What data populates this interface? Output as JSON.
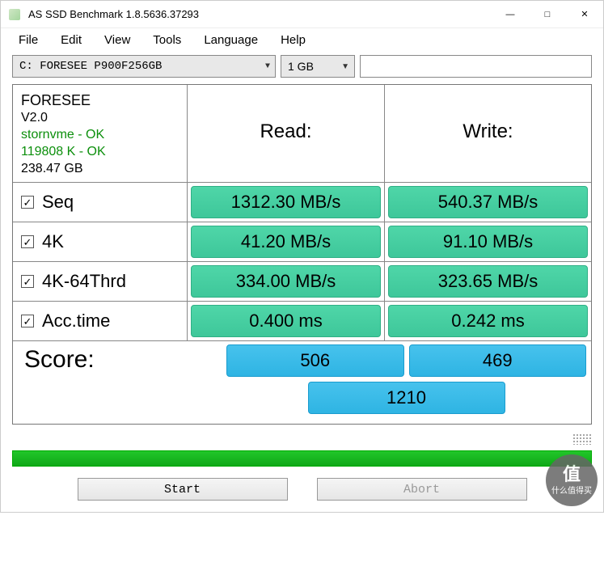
{
  "window": {
    "title": "AS SSD Benchmark 1.8.5636.37293"
  },
  "menu": {
    "file": "File",
    "edit": "Edit",
    "view": "View",
    "tools": "Tools",
    "language": "Language",
    "help": "Help"
  },
  "controls": {
    "drive": "C: FORESEE P900F256GB",
    "size": "1 GB"
  },
  "info": {
    "model": "FORESEE",
    "firmware": "V2.0",
    "driver_line": "stornvme - OK",
    "align_line": "119808 K - OK",
    "capacity": "238.47 GB"
  },
  "headers": {
    "read": "Read:",
    "write": "Write:"
  },
  "tests": {
    "seq": {
      "label": "Seq",
      "read": "1312.30 MB/s",
      "write": "540.37 MB/s"
    },
    "fourk": {
      "label": "4K",
      "read": "41.20 MB/s",
      "write": "91.10 MB/s"
    },
    "fk64": {
      "label": "4K-64Thrd",
      "read": "334.00 MB/s",
      "write": "323.65 MB/s"
    },
    "acc": {
      "label": "Acc.time",
      "read": "0.400 ms",
      "write": "0.242 ms"
    }
  },
  "score": {
    "label": "Score:",
    "read": "506",
    "write": "469",
    "total": "1210"
  },
  "buttons": {
    "start": "Start",
    "abort": "Abort"
  },
  "watermark": {
    "char": "值",
    "text": "什么值得买"
  }
}
